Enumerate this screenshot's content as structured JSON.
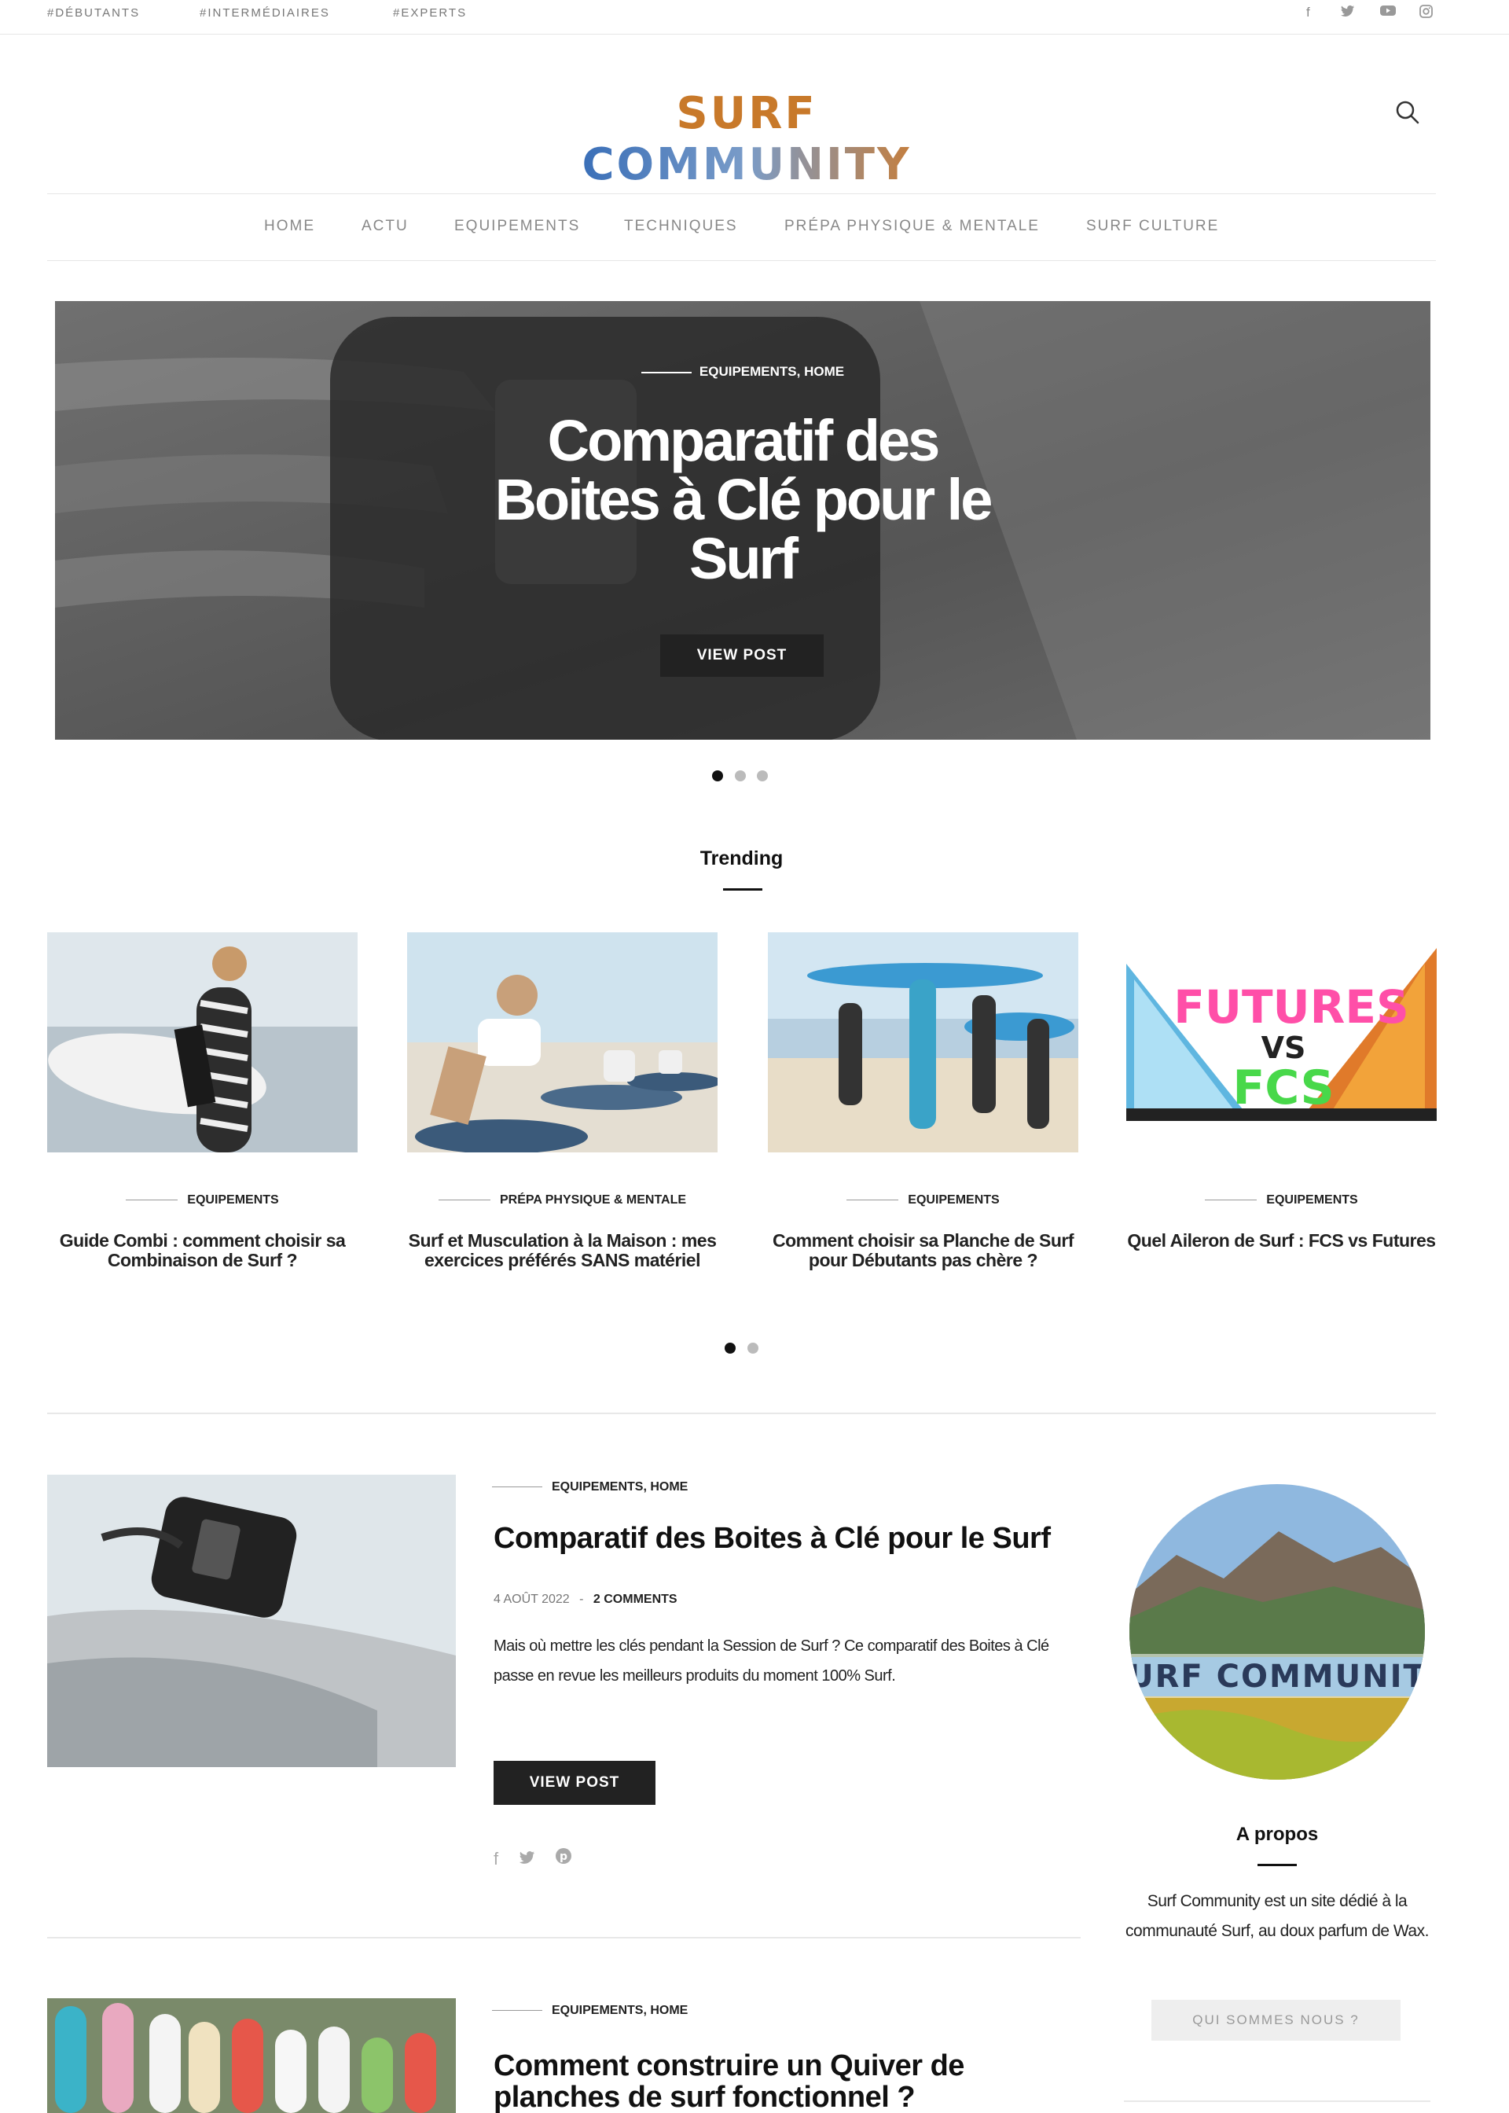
{
  "topbar": {
    "tags": [
      "#DÉBUTANTS",
      "#INTERMÉDIAIRES",
      "#EXPERTS"
    ],
    "social_icons": [
      "facebook-icon",
      "twitter-icon",
      "youtube-icon",
      "instagram-icon"
    ]
  },
  "logo": {
    "word1": "SURF",
    "word2": "COMMUNITY"
  },
  "nav": [
    "HOME",
    "ACTU",
    "EQUIPEMENTS",
    "TECHNIQUES",
    "PRÉPA PHYSIQUE & MENTALE",
    "SURF CULTURE"
  ],
  "hero": {
    "categories": "EQUIPEMENTS, HOME",
    "title": "Comparatif des Boites à Clé pour le Surf",
    "button": "VIEW POST",
    "slides": 3,
    "active_slide": 1
  },
  "trending": {
    "heading": "Trending",
    "items": [
      {
        "category": "EQUIPEMENTS",
        "title": "Guide Combi : comment choisir sa Combinaison de Surf ?"
      },
      {
        "category": "PRÉPA PHYSIQUE & MENTALE",
        "title": "Surf et Musculation à la Maison : mes exercices préférés SANS matériel"
      },
      {
        "category": "EQUIPEMENTS",
        "title": "Comment choisir sa Planche de Surf pour Débutants pas chère ?"
      },
      {
        "category": "EQUIPEMENTS",
        "title": "Quel Aileron de Surf : FCS vs Futures",
        "image_text": [
          "FUTURES",
          "VS",
          "FCS"
        ]
      }
    ],
    "pages": 2,
    "active_page": 1
  },
  "posts": [
    {
      "categories": "EQUIPEMENTS, HOME",
      "title": "Comparatif des Boites à Clé pour le Surf",
      "date": "4 AOÛT 2022",
      "comments": "2 COMMENTS",
      "excerpt": "Mais où mettre les clés pendant la Session de Surf ? Ce comparatif des Boites à Clé passe en revue les meilleurs produits du moment 100% Surf.",
      "button": "VIEW POST"
    },
    {
      "categories": "EQUIPEMENTS, HOME",
      "title": "Comment construire un Quiver de planches de surf fonctionnel ?"
    }
  ],
  "sidebar": {
    "about_image_text": "SURF COMMUNITY",
    "about_title": "A propos",
    "about_text": "Surf Community est un site dédié à la communauté Surf, au doux parfum de Wax.",
    "about_button": "QUI SOMMES NOUS ?"
  }
}
